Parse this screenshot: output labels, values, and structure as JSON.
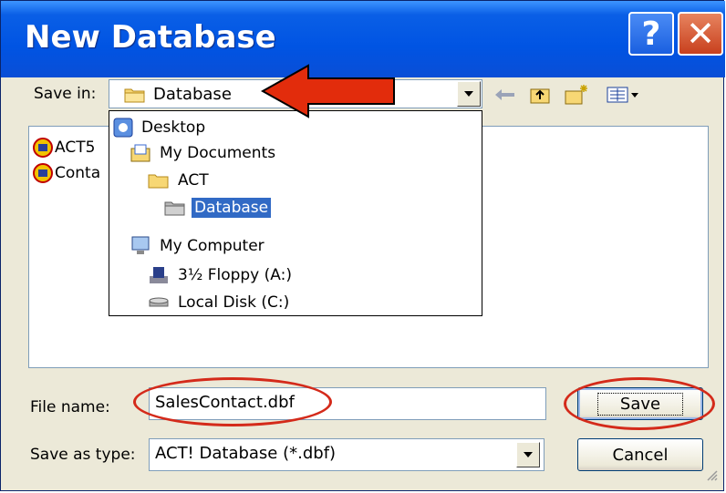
{
  "window": {
    "title": "New Database"
  },
  "save_in": {
    "label": "Save in:",
    "value": "Database"
  },
  "files": [
    {
      "name": "ACT5"
    },
    {
      "name": "Conta"
    }
  ],
  "dropdown_items": [
    {
      "label": "Desktop",
      "icon": "desktop-icon",
      "level": 0
    },
    {
      "label": "My Documents",
      "icon": "my-documents-icon",
      "level": 1
    },
    {
      "label": "ACT",
      "icon": "folder-icon",
      "level": 2
    },
    {
      "label": "Database",
      "icon": "open-folder-icon",
      "level": 3,
      "selected": true
    },
    {
      "label": "My Computer",
      "icon": "my-computer-icon",
      "level": 1
    },
    {
      "label": "3½ Floppy (A:)",
      "icon": "floppy-drive-icon",
      "level": 2
    },
    {
      "label": "Local Disk (C:)",
      "icon": "local-disk-icon",
      "level": 2
    }
  ],
  "file_name": {
    "label": "File name:",
    "value": "SalesContact.dbf"
  },
  "save_as_type": {
    "label": "Save as type:",
    "value": "ACT! Database (*.dbf)"
  },
  "buttons": {
    "save": "Save",
    "cancel": "Cancel",
    "help": "?",
    "close": "✕"
  },
  "toolbar": [
    "back-icon",
    "up-folder-icon",
    "new-folder-icon",
    "view-menu-icon"
  ],
  "colors": {
    "title_bar": "#0054e3",
    "highlight": "#316ac5",
    "annotation": "#d42a1a"
  }
}
